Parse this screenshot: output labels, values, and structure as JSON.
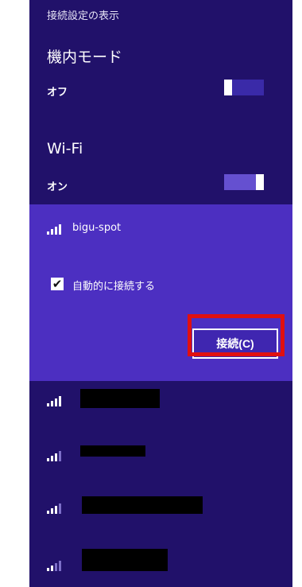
{
  "header": {
    "link_label": "接続設定の表示"
  },
  "airplane_mode": {
    "title": "機内モード",
    "state_label": "オフ",
    "on": false
  },
  "wifi": {
    "title": "Wi-Fi",
    "state_label": "オン",
    "on": true
  },
  "selected_network": {
    "name": "bigu-spot",
    "signal_level": 4,
    "auto_connect_label": "自動的に接続する",
    "auto_connect_checked": true,
    "connect_label": "接続(C)"
  },
  "other_networks": [
    {
      "signal_level": 4,
      "name_redacted": true
    },
    {
      "signal_level": 3,
      "name_redacted": true
    },
    {
      "signal_level": 3,
      "name_redacted": true
    },
    {
      "signal_level": 2,
      "name_redacted": true
    }
  ],
  "colors": {
    "panel": "#21116a",
    "selected": "#4c2fc1",
    "highlight": "#e01010"
  }
}
